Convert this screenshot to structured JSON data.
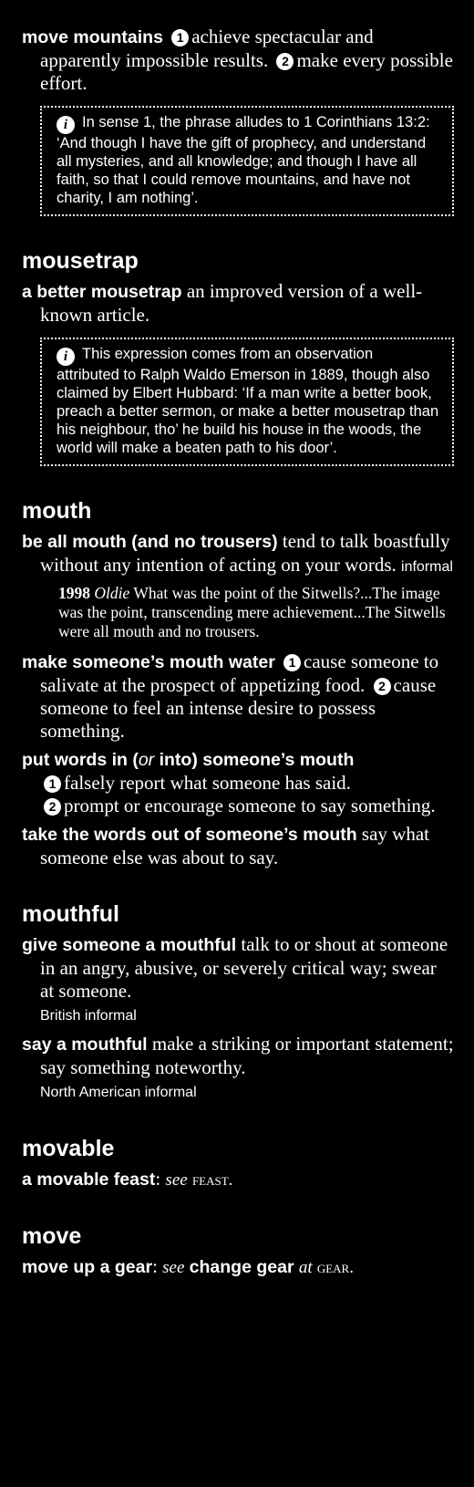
{
  "entries": {
    "mountains": {
      "phrase": "move mountains",
      "s1": "achieve spectacular and apparently impossible results.",
      "s2": "make every possible effort.",
      "note": "In sense 1, the phrase alludes to 1 Corinthians 13:2: ‘And though I have the gift of prophecy, and understand all mysteries, and all knowledge; and though I have all faith, so that I could remove mountains, and have not charity, I am nothing’."
    },
    "mousetrap": {
      "headword": "mousetrap",
      "phrase": "a better mousetrap",
      "def": "an improved version of a well-known article.",
      "note": "This expression comes from an observation attributed to Ralph Waldo Emerson in 1889, though also claimed by Elbert Hubbard: ‘If a man write a better book, preach a better sermon, or make a better mousetrap than his neighbour, tho’ he build his house in the woods, the world will make a beaten path to his door’."
    },
    "mouth": {
      "headword": "mouth",
      "p1": "be all mouth (and no trousers)",
      "d1": "tend to talk boastfully without any intention of acting on your words.",
      "r1": "informal",
      "q_year": "1998",
      "q_src": "Oldie",
      "q_text": "What was the point of the Sitwells?...The image was the point, transcending mere achievement...The Sitwells were all mouth and no trousers.",
      "p2": "make someone’s mouth water",
      "d2a": "cause someone to salivate at the prospect of appetizing food.",
      "d2b": "cause someone to feel an intense desire to possess something.",
      "p3a": "put words in (",
      "p3or": "or",
      "p3b": " into) someone’s mouth",
      "d3a": "falsely report what someone has said.",
      "d3b": "prompt or encourage someone to say something.",
      "p4": "take the words out of someone’s mouth",
      "d4": "say what someone else was about to say."
    },
    "mouthful": {
      "headword": "mouthful",
      "p1": "give someone a mouthful",
      "d1": "talk to or shout at someone in an angry, abusive, or severely critical way; swear at someone.",
      "r1": "British informal",
      "p2": "say a mouthful",
      "d2": "make a striking or important statement; say something noteworthy.",
      "r2": "North American informal"
    },
    "movable": {
      "headword": "movable",
      "phrase": "a movable feast",
      "see": "see",
      "target": "feast."
    },
    "move": {
      "headword": "move",
      "phrase": "move up a gear",
      "see": "see",
      "target_phrase": "change gear",
      "at": "at",
      "target": "gear."
    }
  },
  "markers": {
    "one": "1",
    "two": "2",
    "info": "i"
  }
}
